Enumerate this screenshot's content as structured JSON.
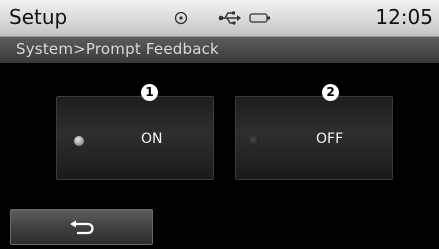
{
  "status_bar": {
    "title": "Setup",
    "clock": "12:05",
    "icons": [
      "disc-icon",
      "usb-icon",
      "battery-icon"
    ]
  },
  "breadcrumb": "System>Prompt Feedback",
  "options": [
    {
      "number": "1",
      "label": "ON",
      "selected": true
    },
    {
      "number": "2",
      "label": "OFF",
      "selected": false
    }
  ],
  "back_button": {
    "icon": "back-arrow-icon"
  }
}
